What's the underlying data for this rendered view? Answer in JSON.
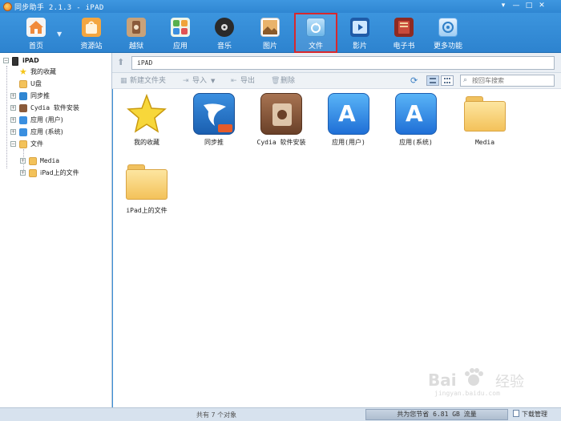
{
  "window": {
    "title": "同步助手 2.1.3 - iPAD",
    "controls": [
      "▾",
      "—",
      "□",
      "✕"
    ]
  },
  "toolbar": {
    "items": [
      {
        "label": "首页",
        "icon": "home-icon",
        "color": "#f08a3c"
      },
      {
        "label": "资源站",
        "icon": "bag-icon",
        "color": "#f3a640"
      },
      {
        "label": "越狱",
        "icon": "jailbreak-icon",
        "color": "#a77b4c"
      },
      {
        "label": "应用",
        "icon": "apps-icon",
        "color": "#58b04c"
      },
      {
        "label": "音乐",
        "icon": "music-icon",
        "color": "#3a3a3a"
      },
      {
        "label": "图片",
        "icon": "picture-icon",
        "color": "#d9a15a"
      },
      {
        "label": "文件",
        "icon": "file-icon",
        "color": "#6db6e8"
      },
      {
        "label": "影片",
        "icon": "movie-icon",
        "color": "#2b6fc4"
      },
      {
        "label": "电子书",
        "icon": "ebook-icon",
        "color": "#b43a2e"
      },
      {
        "label": "更多功能",
        "icon": "more-features-icon",
        "color": "#5fa6e6"
      }
    ],
    "active_index": 6
  },
  "path": {
    "value": "iPAD"
  },
  "actions": {
    "new_folder": "新建文件夹",
    "import": "导入",
    "export": "导出",
    "delete": "删除",
    "search_placeholder": "按回车搜索"
  },
  "sidebar": {
    "device": "iPAD",
    "items": [
      {
        "label": "我的收藏",
        "icon": "star-icon",
        "color": "#f5c518"
      },
      {
        "label": "U盘",
        "icon": "folder-icon",
        "color": "#f3c25a"
      },
      {
        "label": "同步推",
        "icon": "tongbutui-icon",
        "color": "#2f86d2"
      },
      {
        "label": "Cydia 软件安装",
        "icon": "cydia-icon",
        "color": "#8a5a3a"
      },
      {
        "label": "应用 (用户)",
        "icon": "appstore-icon",
        "color": "#2f86d2"
      },
      {
        "label": "应用 (系统)",
        "icon": "appstore-icon",
        "color": "#2f86d2"
      },
      {
        "label": "文件",
        "icon": "folder-icon",
        "color": "#f3c25a"
      },
      {
        "label": "Media",
        "icon": "folder-icon",
        "color": "#f3c25a"
      },
      {
        "label": "iPad上的文件",
        "icon": "folder-icon",
        "color": "#f3c25a"
      }
    ]
  },
  "files": [
    {
      "label": "我的收藏",
      "icon": "star-icon"
    },
    {
      "label": "同步推",
      "icon": "tongbutui-icon"
    },
    {
      "label": "Cydia 软件安装",
      "icon": "cydia-icon"
    },
    {
      "label": "应用(用户)",
      "icon": "appstore-icon"
    },
    {
      "label": "应用(系统)",
      "icon": "appstore-icon"
    },
    {
      "label": "Media",
      "icon": "folder-icon"
    },
    {
      "label": "iPad上的文件",
      "icon": "folder-icon"
    }
  ],
  "status": {
    "count": "共有 7 个对象",
    "saved": "共为您节省 6.81 GB 流量",
    "download": "下载管理"
  },
  "watermark": {
    "brand": "Bai",
    "brand2": "经验",
    "url": "jingyan.baidu.com"
  }
}
